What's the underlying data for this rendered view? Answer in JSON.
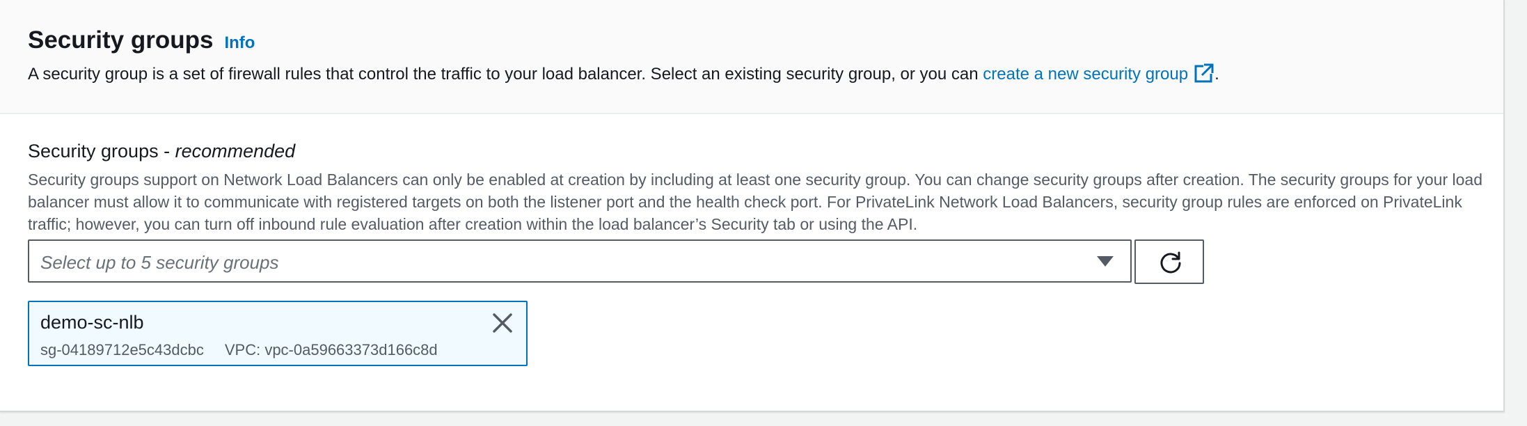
{
  "header": {
    "title": "Security groups",
    "info_label": "Info",
    "description_prefix": "A security group is a set of firewall rules that control the traffic to your load balancer. Select an existing security group, or you can ",
    "description_link": "create a new security group",
    "description_suffix": "."
  },
  "field": {
    "label_prefix": "Security groups - ",
    "label_emphasis": "recommended",
    "description": "Security groups support on Network Load Balancers can only be enabled at creation by including at least one security group. You can change security groups after creation. The security groups for your load balancer must allow it to communicate with registered targets on both the listener port and the health check port. For PrivateLink Network Load Balancers, security group rules are enforced on PrivateLink traffic; however, you can turn off inbound rule evaluation after creation within the load balancer’s Security tab or using the API."
  },
  "select": {
    "placeholder": "Select up to 5 security groups"
  },
  "selected_groups": [
    {
      "name": "demo-sc-nlb",
      "id": "sg-04189712e5c43dcbc",
      "vpc": "VPC: vpc-0a59663373d166c8d"
    }
  ],
  "colors": {
    "link": "#0073bb",
    "token_bg": "#f1faff",
    "token_border": "#0073bb",
    "text": "#16191f",
    "secondary_text": "#545b64"
  },
  "icons": {
    "external": "external-link-icon",
    "dropdown": "caret-down-icon",
    "refresh": "refresh-icon",
    "remove": "close-icon"
  }
}
